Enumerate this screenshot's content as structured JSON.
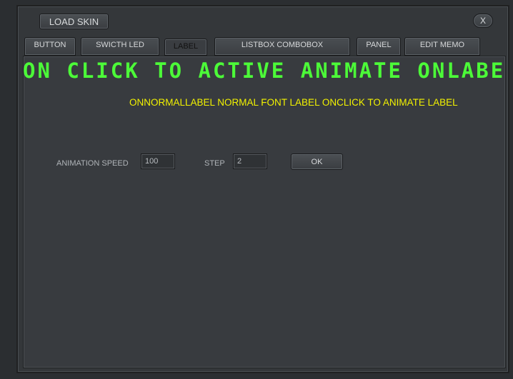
{
  "header": {
    "load_skin_label": "LOAD SKIN",
    "close_label": "X"
  },
  "tabs": [
    {
      "label": "BUTTON"
    },
    {
      "label": "SWICTH LED"
    },
    {
      "label": "LABEL"
    },
    {
      "label": "LISTBOX COMBOBOX"
    },
    {
      "label": "PANEL"
    },
    {
      "label": "EDIT MEMO"
    }
  ],
  "main": {
    "animated_label": "ON CLICK TO ACTIVE ANIMATE ONLABEL",
    "normal_label": "ONNORMALLABEL NORMAL FONT LABEL ONCLICK TO ANIMATE LABEL",
    "speed_label": "ANIMATION SPEED",
    "speed_value": "100",
    "step_label": "STEP",
    "step_value": "2",
    "ok_label": "OK"
  },
  "colors": {
    "animated_label": "#4cfa38",
    "normal_label": "#f2f200"
  }
}
